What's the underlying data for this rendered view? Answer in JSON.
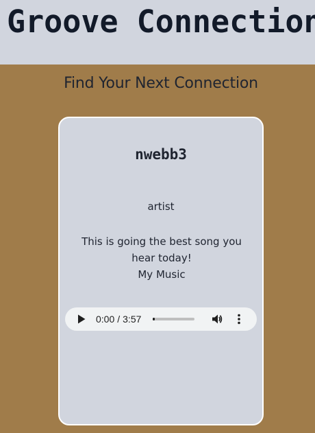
{
  "header": {
    "app_title": "Groove Connection"
  },
  "main": {
    "subtitle": "Find Your Next Connection"
  },
  "card": {
    "username": "nwebb3",
    "role": "artist",
    "description": "This is going the best song you hear today!",
    "music_link_label": "My Music",
    "audio": {
      "current_time": "0:00",
      "separator": "/",
      "duration": "3:57",
      "progress": 0.05,
      "play_icon": "play-icon",
      "volume_icon": "volume-icon",
      "menu_icon": "more-vert-icon"
    }
  },
  "colors": {
    "page_background": "#a07c4a",
    "header_background": "#d1d5de",
    "card_background": "#d1d5de",
    "card_border": "#ffffff",
    "player_background": "#f1f3f4",
    "text_dark": "#1f2430"
  }
}
